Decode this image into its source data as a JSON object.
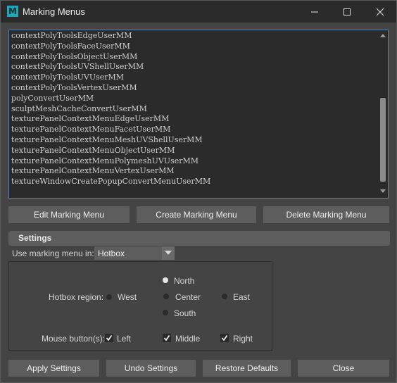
{
  "window": {
    "title": "Marking Menus",
    "app_icon_letter": "M",
    "accent_color": "#1fa5b5"
  },
  "menu_list": {
    "items": [
      "contextPolyToolsEdgeUserMM",
      "contextPolyToolsFaceUserMM",
      "contextPolyToolsObjectUserMM",
      "contextPolyToolsUVShellUserMM",
      "contextPolyToolsUVUserMM",
      "contextPolyToolsVertexUserMM",
      "polyConvertUserMM",
      "sculptMeshCacheConvertUserMM",
      "texturePanelContextMenuEdgeUserMM",
      "texturePanelContextMenuFacetUserMM",
      "texturePanelContextMenuMeshUVShellUserMM",
      "texturePanelContextMenuObjectUserMM",
      "texturePanelContextMenuPolymeshUVUserMM",
      "texturePanelContextMenuVertexUserMM",
      "textureWindowCreatePopupConvertMenuUserMM"
    ]
  },
  "actions": {
    "edit": "Edit Marking Menu",
    "create": "Create Marking Menu",
    "delete": "Delete Marking Menu"
  },
  "settings": {
    "header": "Settings",
    "use_label": "Use marking menu in:",
    "use_value": "Hotbox",
    "hotbox_region_label": "Hotbox region:",
    "regions": {
      "north": "North",
      "west": "West",
      "center": "Center",
      "east": "East",
      "south": "South"
    },
    "selected_region": "North",
    "mouse_label": "Mouse button(s):",
    "buttons": {
      "left": "Left",
      "middle": "Middle",
      "right": "Right"
    },
    "checked": {
      "left": true,
      "middle": true,
      "right": true
    }
  },
  "footer": {
    "apply": "Apply Settings",
    "undo": "Undo Settings",
    "restore": "Restore Defaults",
    "close": "Close"
  }
}
